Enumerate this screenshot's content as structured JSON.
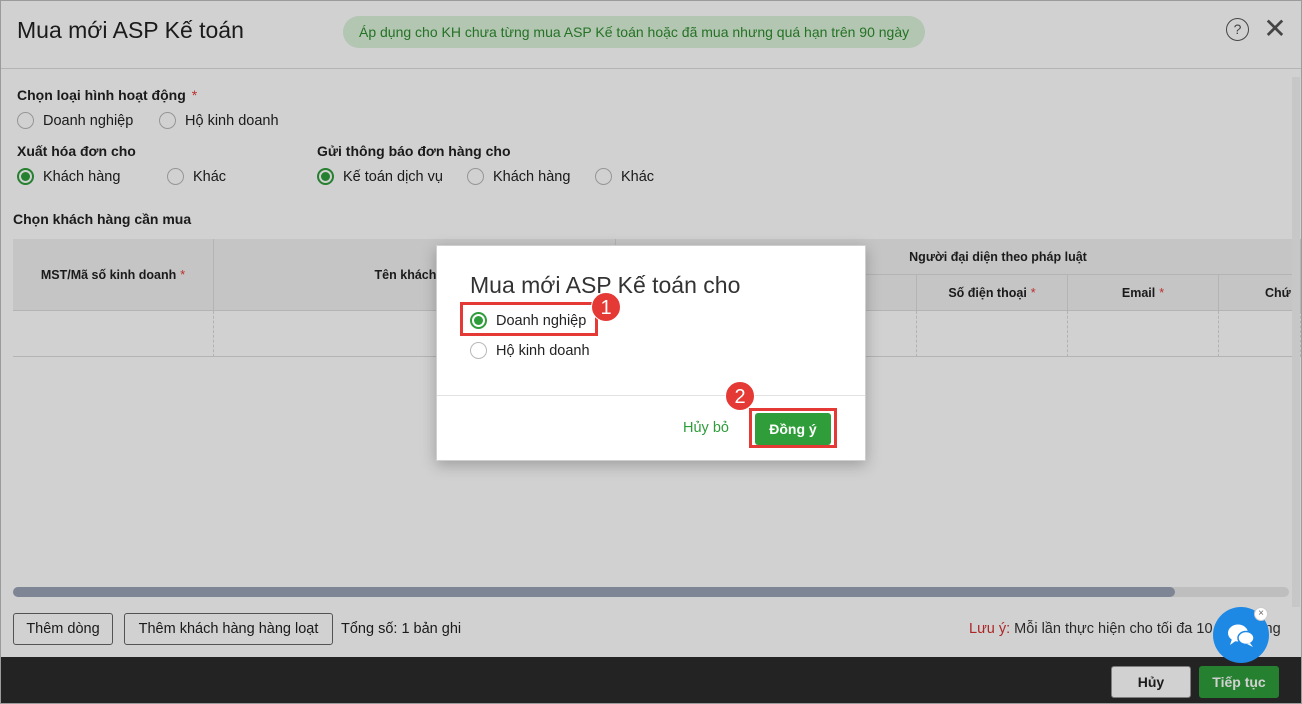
{
  "header": {
    "title": "Mua mới ASP Kế toán",
    "notice": "Áp dụng cho KH chưa từng mua ASP Kế toán hoặc đã mua nhưng quá hạn trên 90 ngày",
    "help_icon": "help-circle-icon",
    "close_icon": "close-icon",
    "help_glyph": "?",
    "close_glyph": "✕"
  },
  "form": {
    "activity_type": {
      "label": "Chọn loại hình hoạt động",
      "required_mark": "*",
      "options": [
        "Doanh nghiệp",
        "Hộ kinh doanh"
      ],
      "selected": null
    },
    "invoice_for": {
      "label": "Xuất hóa đơn cho",
      "options": [
        "Khách hàng",
        "Khác"
      ],
      "selected": "Khách hàng"
    },
    "notify_to": {
      "label": "Gửi thông báo đơn hàng cho",
      "options": [
        "Kế toán dịch vụ",
        "Khách hàng",
        "Khác"
      ],
      "selected": "Kế toán dịch vụ"
    }
  },
  "table": {
    "title": "Chọn khách hàng cần mua",
    "headers": {
      "tax_code": "MST/Mã số kinh doanh",
      "customer_name": "Tên khách hà",
      "legal_rep_group": "Người đại diện theo pháp luật",
      "phone": "Số điện thoại",
      "email": "Email",
      "position": "Chứ"
    },
    "required_mark": "*",
    "rows": [
      [
        "",
        "",
        "",
        "",
        "",
        ""
      ]
    ]
  },
  "bottom": {
    "add_row": "Thêm dòng",
    "add_bulk": "Thêm khách hàng hàng loạt",
    "total": "Tổng số: 1 bản ghi",
    "note_label": "Lưu ý:",
    "note_text": " Mỗi lần thực hiện cho tối đa 10",
    "note_tail": "ng"
  },
  "footer": {
    "cancel": "Hủy",
    "continue": "Tiếp tục"
  },
  "dialog": {
    "title": "Mua mới ASP Kế toán cho",
    "options": [
      "Doanh nghiệp",
      "Hộ kinh doanh"
    ],
    "selected": "Doanh nghiệp",
    "cancel": "Hủy bỏ",
    "ok": "Đồng ý"
  },
  "annotations": {
    "step1": "1",
    "step2": "2",
    "highlight_color": "#e53935"
  },
  "chat": {
    "icon": "chat-bubble-icon",
    "close_glyph": "×"
  },
  "colors": {
    "accent": "#2e9d3a",
    "notice_bg": "#d9f2d9",
    "footer_bg": "#2b2b2b",
    "chat": "#1e88e5"
  }
}
